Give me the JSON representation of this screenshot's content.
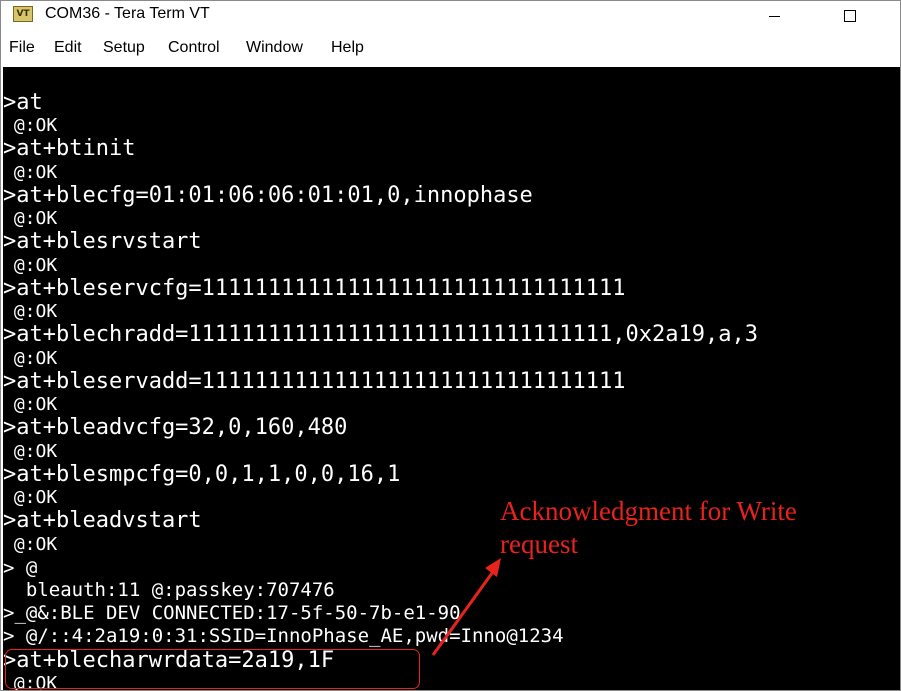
{
  "window": {
    "title": "COM36 - Tera Term VT",
    "icon_text": "VT"
  },
  "menu": [
    "File",
    "Edit",
    "Setup",
    "Control",
    "Window",
    "Help"
  ],
  "terminal": {
    "lines": [
      ">at",
      " @:OK",
      ">at+btinit",
      " @:OK",
      ">at+blecfg=01:01:06:06:01:01,0,innophase",
      " @:OK",
      ">at+blesrvstart",
      " @:OK",
      ">at+bleservcfg=11111111111111111111111111111111",
      " @:OK",
      ">at+blechradd=11111111111111111111111111111111,0x2a19,a,3",
      " @:OK",
      ">at+bleservadd=11111111111111111111111111111111",
      " @:OK",
      ">at+bleadvcfg=32,0,160,480",
      " @:OK",
      ">at+blesmpcfg=0,0,1,1,0,0,16,1",
      " @:OK",
      ">at+bleadvstart",
      " @:OK",
      "> @",
      "  bleauth:11 @:passkey:707476",
      ">_@&:BLE DEV CONNECTED:17-5f-50-7b-e1-90",
      "> @/::4:2a19:0:31:SSID=InnoPhase_AE,pwd=Inno@1234",
      ">at+blecharwrdata=2a19,1F",
      " @:OK"
    ]
  },
  "annotation": {
    "line1": "Acknowledgment for Write",
    "line2": "request",
    "color": "#e8221c"
  }
}
